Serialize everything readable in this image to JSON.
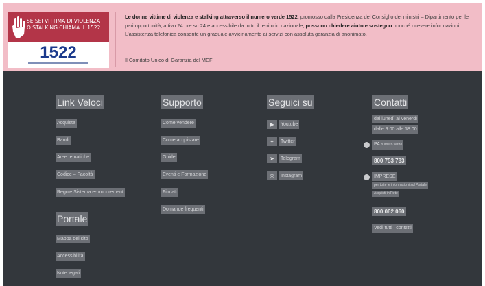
{
  "banner": {
    "card_line1": "SE SEI VITTIMA DI VIOLENZA",
    "card_line2": "O STALKING CHIAMA IL 1522",
    "card_number": "1522",
    "text_part1": "Le donne vittime di violenza e stalking attraverso il numero verde 1522",
    "text_part2": ", promosso dalla Presidenza del Consiglio dei ministri – Dipartimento per le pari opportunità, attivo 24 ore su 24 e accessibile da tutto il territorio nazionale, ",
    "text_part3": "possono chiedere aiuto e sostegno",
    "text_part4": " nonché ricevere informazioni. L'assistenza telefonica consente un graduale avvicinamento ai servizi con assoluta garanzia di anonimato.",
    "footer_text": "Il Comitato Unico di Garanzia del MEF"
  },
  "footer": {
    "link_veloci": {
      "title": "Link Veloci",
      "items": [
        "Acquista",
        "Bandi",
        "Aree tematiche",
        "Codice – Facoltà",
        "Regole Sistema e-procurement"
      ]
    },
    "portale": {
      "title": "Portale",
      "items": [
        "Mappa del sito",
        "Accessibilità",
        "Note legali"
      ]
    },
    "supporto": {
      "title": "Supporto",
      "items": [
        "Come vendere",
        "Come acquistare",
        "Guide",
        "Eventi e Formazione",
        "Filmati",
        "Domande frequenti"
      ]
    },
    "seguici": {
      "title": "Seguici su",
      "items": [
        {
          "label": "Youtube",
          "icon": "youtube-icon",
          "glyph": "▶"
        },
        {
          "label": "Twitter",
          "icon": "twitter-icon",
          "glyph": "✦"
        },
        {
          "label": "Telegram",
          "icon": "telegram-icon",
          "glyph": "➤"
        },
        {
          "label": "Instagram",
          "icon": "instagram-icon",
          "glyph": "◎"
        }
      ]
    },
    "contatti": {
      "title": "Contatti",
      "hours_line1": "dal lunedì al venerdì",
      "hours_line2": "dalle 9:00 alle 18:00",
      "pa_label": "PA",
      "pa_note": "numero verde",
      "pa_phone": "800 753 783",
      "imprese_label": "IMPRESE",
      "imprese_note1": "per tutte le informazioni sul Portale",
      "imprese_note2": "Acquisti in Rete",
      "imprese_phone": "800 062 060",
      "all_contacts": "Vedi tutti i contatti"
    }
  }
}
